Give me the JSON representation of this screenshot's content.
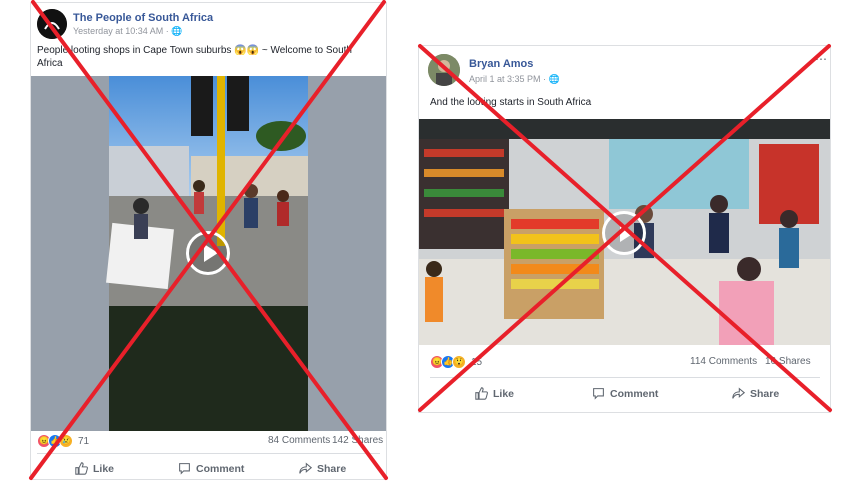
{
  "post_left": {
    "author": "The People of South Africa",
    "timestamp": "Yesterday at 10:34 AM · ",
    "caption": "People looting shops in Cape Town suburbs 😱😱 ~ Welcome to South Africa",
    "reaction_count": "71",
    "comments": "84 Comments",
    "shares": "142 Shares",
    "actions": {
      "like": "Like",
      "comment": "Comment",
      "share": "Share"
    }
  },
  "post_right": {
    "author": "Bryan Amos",
    "timestamp": "April 1 at 3:35 PM · ",
    "caption": "And the looting starts in South Africa",
    "reaction_count": "15",
    "comments": "114 Comments",
    "shares": "16 Shares",
    "actions": {
      "like": "Like",
      "comment": "Comment",
      "share": "Share"
    }
  },
  "colors": {
    "x_overlay": "#e8202a",
    "author_link": "#385898",
    "meta": "#90949c"
  },
  "icons": [
    "globe-icon",
    "play-icon",
    "like-icon",
    "comment-icon",
    "share-icon",
    "angry-reaction-icon",
    "like-reaction-icon",
    "wow-reaction-icon"
  ]
}
